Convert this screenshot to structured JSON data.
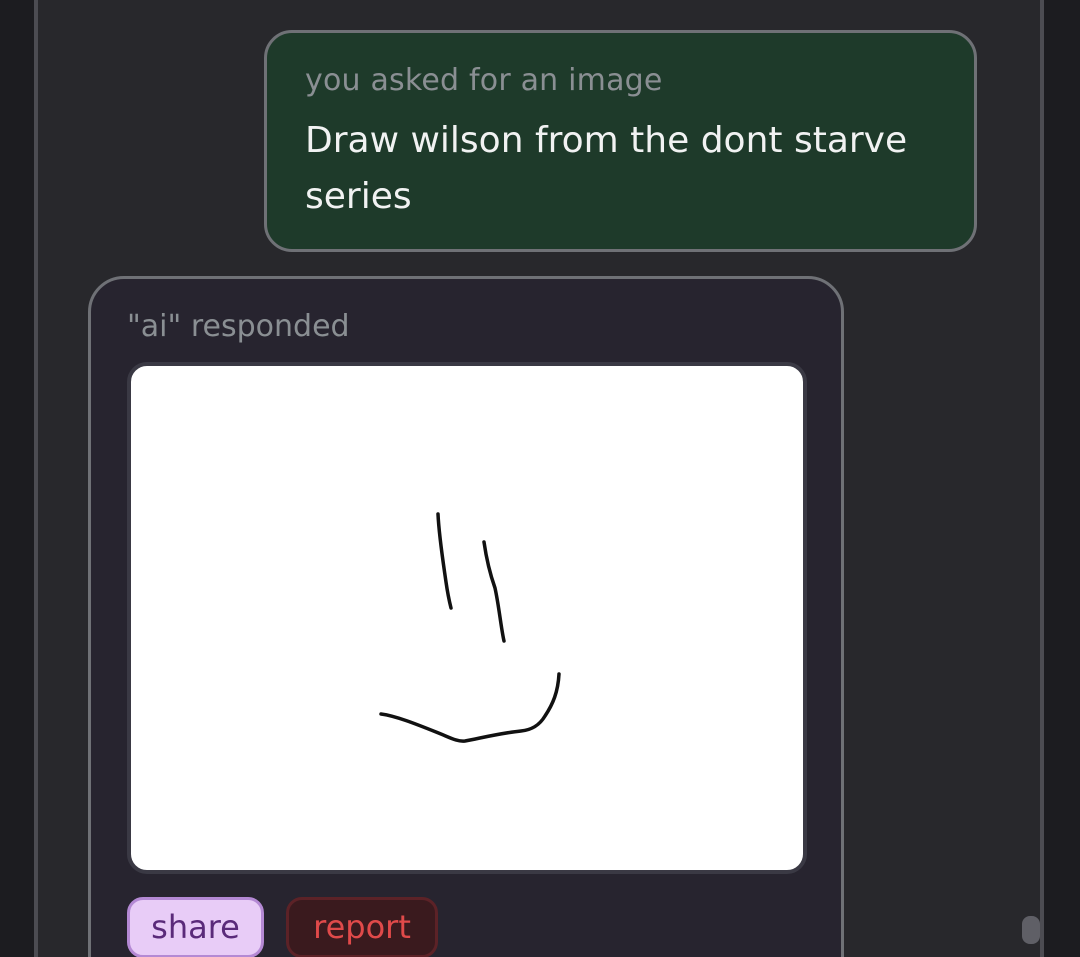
{
  "user_message": {
    "caption": "you asked for an image",
    "prompt": "Draw wilson from the dont starve series"
  },
  "ai_message": {
    "caption": "\"ai\" responded",
    "image_alt": "hand-drawn sketch: two short vertical strokes above a curved smile line"
  },
  "actions": {
    "share_label": "share",
    "report_label": "report"
  },
  "colors": {
    "user_bubble_bg": "#1e3a2a",
    "ai_bubble_bg": "#27242f",
    "share_bg": "#e8ccf7",
    "report_bg": "#3a1a1e",
    "report_text": "#e04a4a"
  }
}
